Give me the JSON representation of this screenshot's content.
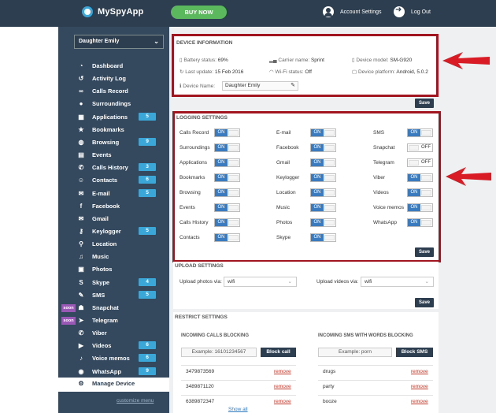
{
  "app": {
    "name": "MySpyApp",
    "buy_label": "BUY NOW",
    "account_label": "Account Settings",
    "logout_label": "Log Out"
  },
  "sidebar": {
    "device_selected": "Daughter Emily",
    "customize_label": "customize menu",
    "items": [
      {
        "label": "Dashboard",
        "icon": "dashboard-icon",
        "glyph": "◔"
      },
      {
        "label": "Activity Log",
        "icon": "history-icon",
        "glyph": "↺"
      },
      {
        "label": "Calls Record",
        "icon": "tape-icon",
        "glyph": "∞"
      },
      {
        "label": "Surroundings",
        "icon": "microphone-icon",
        "glyph": "●"
      },
      {
        "label": "Applications",
        "icon": "grid-icon",
        "glyph": "▦",
        "badge": "5"
      },
      {
        "label": "Bookmarks",
        "icon": "star-icon",
        "glyph": "★"
      },
      {
        "label": "Browsing",
        "icon": "globe-icon",
        "glyph": "◍",
        "badge": "9"
      },
      {
        "label": "Events",
        "icon": "calendar-icon",
        "glyph": "▤"
      },
      {
        "label": "Calls History",
        "icon": "phone-icon",
        "glyph": "✆",
        "badge": "3"
      },
      {
        "label": "Contacts",
        "icon": "users-icon",
        "glyph": "☺",
        "badge": "6"
      },
      {
        "label": "E-mail",
        "icon": "envelope-icon",
        "glyph": "✉",
        "badge": "5"
      },
      {
        "label": "Facebook",
        "icon": "facebook-icon",
        "glyph": "f"
      },
      {
        "label": "Gmail",
        "icon": "gmail-icon",
        "glyph": "✉"
      },
      {
        "label": "Keylogger",
        "icon": "key-icon",
        "glyph": "⚷",
        "badge": "5"
      },
      {
        "label": "Location",
        "icon": "pin-icon",
        "glyph": "⚲"
      },
      {
        "label": "Music",
        "icon": "music-icon",
        "glyph": "♫"
      },
      {
        "label": "Photos",
        "icon": "image-icon",
        "glyph": "▣"
      },
      {
        "label": "Skype",
        "icon": "skype-icon",
        "glyph": "S",
        "badge": "4"
      },
      {
        "label": "SMS",
        "icon": "chat-icon",
        "glyph": "✎",
        "badge": "5"
      },
      {
        "label": "Snapchat",
        "icon": "ghost-icon",
        "glyph": "☗",
        "soon": "soon"
      },
      {
        "label": "Telegram",
        "icon": "paper-plane-icon",
        "glyph": "➤",
        "soon": "soon"
      },
      {
        "label": "Viber",
        "icon": "viber-icon",
        "glyph": "✆"
      },
      {
        "label": "Videos",
        "icon": "video-icon",
        "glyph": "▶",
        "badge": "6"
      },
      {
        "label": "Voice memos",
        "icon": "mic-icon",
        "glyph": "♪",
        "badge": "6"
      },
      {
        "label": "WhatsApp",
        "icon": "whatsapp-icon",
        "glyph": "◉",
        "badge": "9"
      },
      {
        "label": "Manage Device",
        "icon": "gears-icon",
        "glyph": "⚙",
        "active": true
      }
    ]
  },
  "device_info": {
    "title": "DEVICE INFORMATION",
    "battery": "Battery status: ",
    "battery_val": "69%",
    "carrier": "Carrier name: ",
    "carrier_val": "Sprint",
    "model": "Device model: ",
    "model_val": "SM-G920",
    "last_update": "Last update: ",
    "last_update_val": "15 Feb 2016",
    "wifi": "Wi-Fi status: ",
    "wifi_val": "Off",
    "platform": "Device platform: ",
    "platform_val": "Android, 5.0.2",
    "name_label": "Device Name:",
    "name_val": "Daughter Emily",
    "save_label": "Save"
  },
  "logging": {
    "title": "LOGGING SETTINGS",
    "save_label": "Save",
    "on_label": "ON",
    "off_label": "OFF",
    "columns": [
      [
        {
          "label": "Calls Record",
          "on": true
        },
        {
          "label": "Surroundings",
          "on": true
        },
        {
          "label": "Applications",
          "on": true
        },
        {
          "label": "Bookmarks",
          "on": true
        },
        {
          "label": "Browsing",
          "on": true
        },
        {
          "label": "Events",
          "on": true
        },
        {
          "label": "Calls History",
          "on": true
        },
        {
          "label": "Contacts",
          "on": true
        }
      ],
      [
        {
          "label": "E-mail",
          "on": true
        },
        {
          "label": "Facebook",
          "on": true
        },
        {
          "label": "Gmail",
          "on": true
        },
        {
          "label": "Keylogger",
          "on": true
        },
        {
          "label": "Location",
          "on": true
        },
        {
          "label": "Music",
          "on": true
        },
        {
          "label": "Photos",
          "on": true
        },
        {
          "label": "Skype",
          "on": true
        }
      ],
      [
        {
          "label": "SMS",
          "on": true
        },
        {
          "label": "Snapchat",
          "on": false
        },
        {
          "label": "Telegram",
          "on": false
        },
        {
          "label": "Viber",
          "on": true
        },
        {
          "label": "Videos",
          "on": true
        },
        {
          "label": "Voice memos",
          "on": true
        },
        {
          "label": "WhatsApp",
          "on": true
        }
      ]
    ]
  },
  "upload": {
    "title": "UPLOAD SETTINGS",
    "photos_label": "Upload photos via:",
    "photos_val": "wifi",
    "videos_label": "Upload videos via:",
    "videos_val": "wifi",
    "save_label": "Save"
  },
  "restrict": {
    "title": "RESTRICT SETTINGS",
    "calls_title": "INCOMING CALLS BLOCKING",
    "calls_example": "Example: 16101234567",
    "calls_btn": "Block call",
    "calls_rows": [
      "3479873569",
      "3489871120",
      "6389872347"
    ],
    "sms_title": "INCOMING SMS WITH WORDS BLOCKING",
    "sms_example": "Example: porn",
    "sms_btn": "Block SMS",
    "sms_rows": [
      "drugs",
      "party",
      "booze"
    ],
    "remove_label": "remove",
    "show_all": "Show all"
  },
  "colors": {
    "topbar": "#2c3e50",
    "sidebar": "#34495e",
    "accent": "#3aa7d8",
    "buy": "#5cb85c",
    "highlight_frame": "#a0151f",
    "soon": "#9b59b6"
  }
}
